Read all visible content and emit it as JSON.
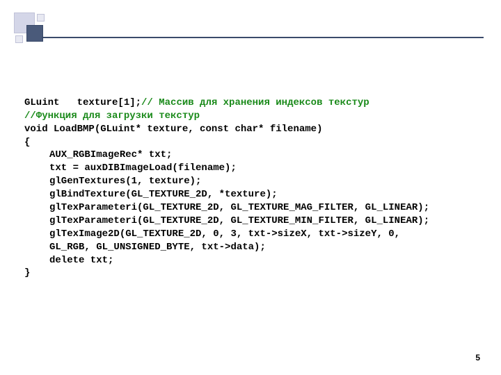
{
  "page_number": "5",
  "code": {
    "l1a": "GLuint   texture[1];",
    "l1b": "// Массив для хранения индексов текстур",
    "l2": "//Функция для загрузки текстур",
    "l3": "void LoadBMP(GLuint* texture, const char* filename)",
    "l4": "{",
    "l5": "AUX_RGBImageRec* txt;",
    "l6": "txt = auxDIBImageLoad(filename);",
    "l7": "glGenTextures(1, texture);",
    "l8": "glBindTexture(GL_TEXTURE_2D, *texture);",
    "l9": "glTexParameteri(GL_TEXTURE_2D, GL_TEXTURE_MAG_FILTER, GL_LINEAR);",
    "l10": "glTexParameteri(GL_TEXTURE_2D, GL_TEXTURE_MIN_FILTER, GL_LINEAR);",
    "l11": "glTexImage2D(GL_TEXTURE_2D, 0, 3, txt->sizeX, txt->sizeY, 0,",
    "l12": "GL_RGB, GL_UNSIGNED_BYTE, txt->data);",
    "l13": "delete txt;",
    "l14": "}"
  }
}
